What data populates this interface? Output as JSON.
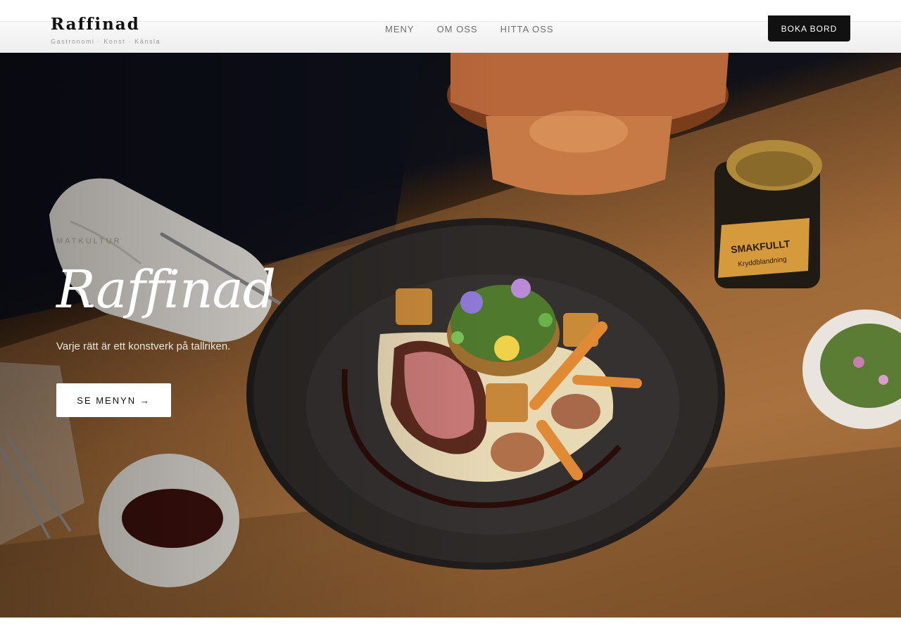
{
  "header": {
    "brand_name": "Raffinad",
    "brand_tagline": "Gastronomi · Konst · Känsla",
    "nav": [
      {
        "label": "MENY"
      },
      {
        "label": "OM OSS"
      },
      {
        "label": "HITTA OSS"
      }
    ],
    "cta_label": "BOKA BORD"
  },
  "hero": {
    "eyebrow": "MATKULTUR",
    "title": "Raffinad",
    "subtitle": "Varje rätt är ett konstverk på tallriken.",
    "button_label": "SE MENYN →",
    "jar_label_main": "SMAKFULLT",
    "jar_label_sub": "Kryddblandning"
  },
  "colors": {
    "cta_bg": "#111111",
    "hero_text": "#ffffff",
    "wood": "#a06a3a"
  },
  "icons": [
    "arrow-right-icon"
  ]
}
